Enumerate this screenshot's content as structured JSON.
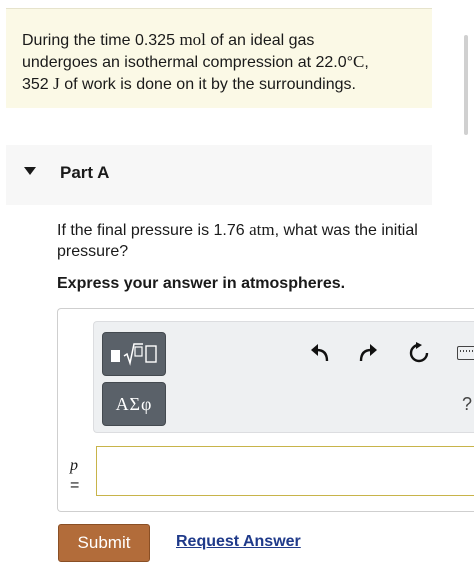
{
  "problem": {
    "line1_before": "During the time 0.325",
    "line1_unit": "mol",
    "line1_after": "of an ideal gas",
    "line2_before": "undergoes an isothermal compression at 22.0°",
    "line2_unit": "C",
    "line2_after": ",",
    "line3_value": "352",
    "line3_unit": "J",
    "line3_after": "of work is done on it by the surroundings."
  },
  "part": {
    "title": "Part A"
  },
  "question": {
    "text_before": "If the final pressure is 1.76",
    "unit": "atm",
    "text_after": ", what was the initial pressure?",
    "instruction": "Express your answer in atmospheres."
  },
  "toolbar": {
    "templates_icon": "templates-sqrt-icon",
    "symbols_label": "ΑΣφ",
    "undo_icon": "undo-icon",
    "redo_icon": "redo-icon",
    "reset_icon": "reset-icon",
    "keyboard_icon": "keyboard-icon",
    "help_label": "?"
  },
  "answer": {
    "variable": "p",
    "equals": "=",
    "value": ""
  },
  "actions": {
    "submit_label": "Submit",
    "request_label": "Request Answer"
  },
  "colors": {
    "problem_bg": "#fbf9e6",
    "submit_bg": "#b26c3a",
    "link": "#1f3a8a",
    "tool_button": "#5a6169",
    "input_border": "#c8b44a"
  }
}
